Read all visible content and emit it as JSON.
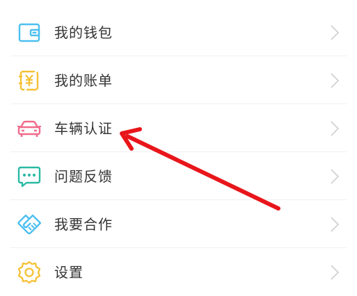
{
  "menu": {
    "items": [
      {
        "label": "我的钱包",
        "icon": "wallet-icon",
        "color": "#4bbff0"
      },
      {
        "label": "我的账单",
        "icon": "bill-icon",
        "color": "#f5c033"
      },
      {
        "label": "车辆认证",
        "icon": "car-icon",
        "color": "#f06a8a"
      },
      {
        "label": "问题反馈",
        "icon": "feedback-icon",
        "color": "#2bb9a4"
      },
      {
        "label": "我要合作",
        "icon": "handshake-icon",
        "color": "#4bbff0"
      },
      {
        "label": "设置",
        "icon": "gear-icon",
        "color": "#f5c033"
      }
    ]
  },
  "annotation": {
    "arrow_color": "#e8161b"
  }
}
